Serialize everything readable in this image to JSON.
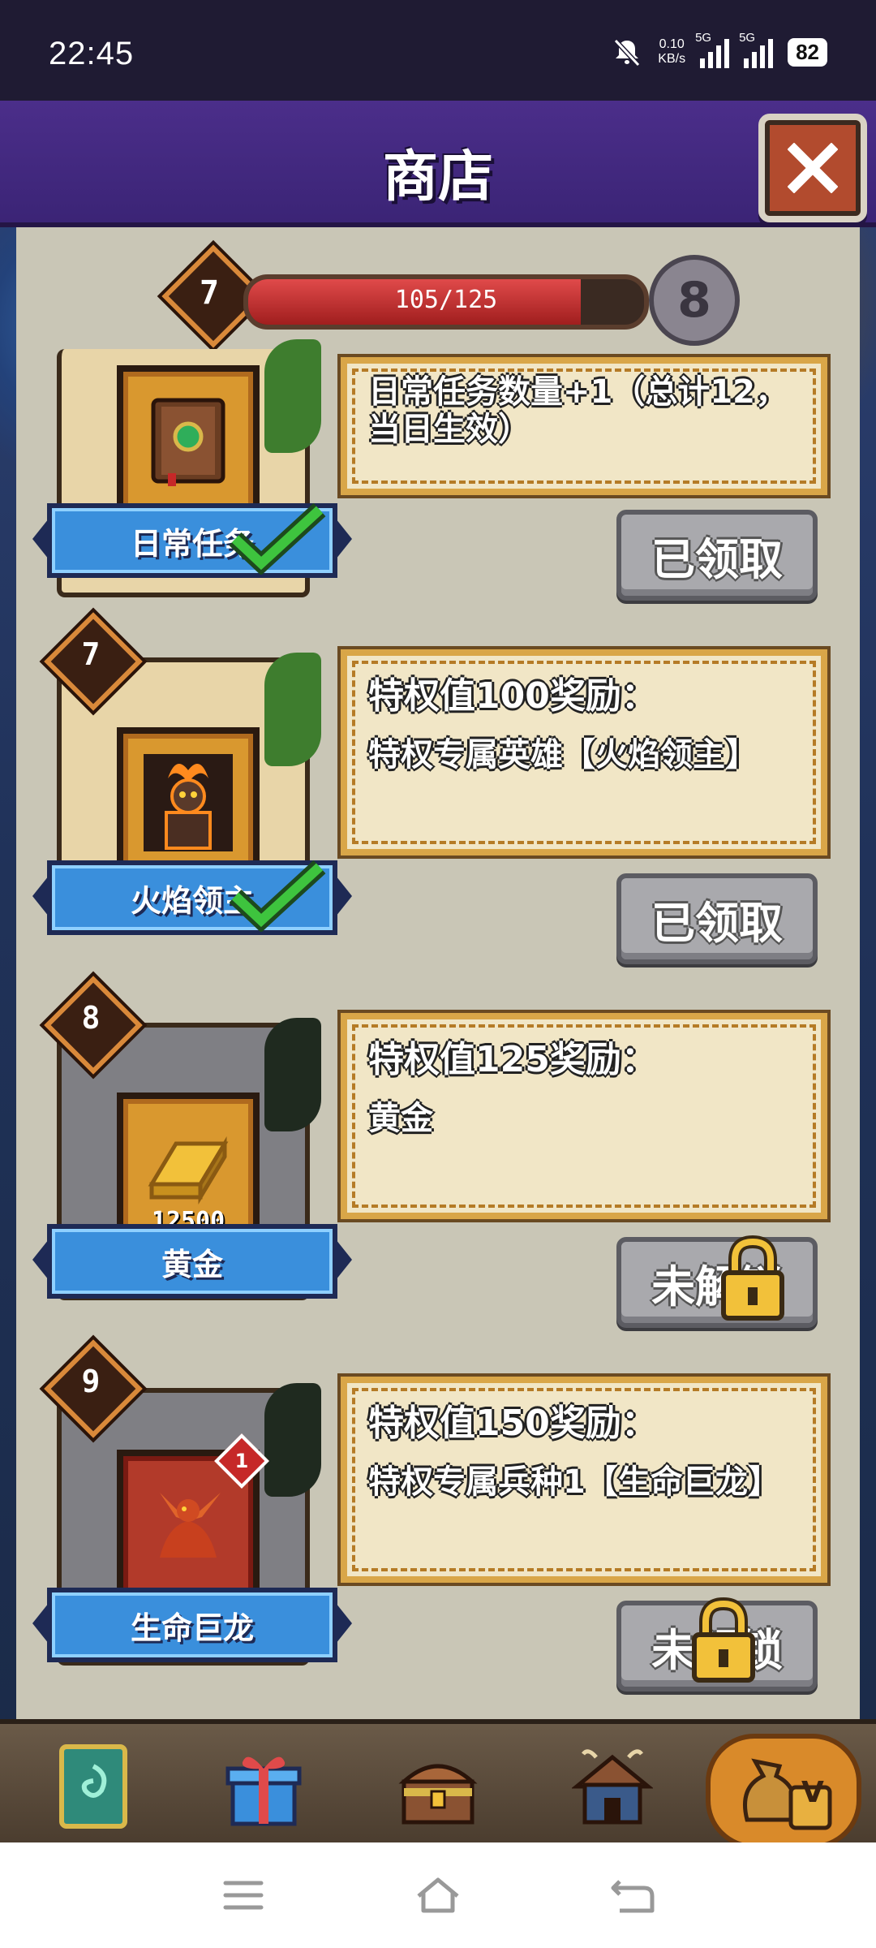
{
  "status_bar": {
    "time": "22:45",
    "net_speed_value": "0.10",
    "net_speed_unit": "KB/s",
    "signal1": "5G",
    "signal2": "5G",
    "battery": "82"
  },
  "header": {
    "title": "商店"
  },
  "level": {
    "current": "7",
    "progress_text": "105/125",
    "progress_fraction": 0.84,
    "next": "8"
  },
  "rewards": [
    {
      "card_label": "日常任务",
      "desc_title": "日常任务数量+1（总计12，当日生效）",
      "desc_sub": "",
      "button": "已领取",
      "state": "claimed"
    },
    {
      "rank": "7",
      "card_label": "火焰领主",
      "desc_title": "特权值100奖励：",
      "desc_sub": "特权专属英雄【火焰领主】",
      "button": "已领取",
      "state": "claimed"
    },
    {
      "rank": "8",
      "card_label": "黄金",
      "amount": "12500",
      "desc_title": "特权值125奖励：",
      "desc_sub": "黄金",
      "button": "未解锁",
      "state": "locked"
    },
    {
      "rank": "9",
      "card_label": "生命巨龙",
      "badge": "1",
      "desc_title": "特权值150奖励：",
      "desc_sub": "特权专属兵种1【生命巨龙】",
      "button": "未解锁",
      "state": "locked"
    }
  ],
  "tabs": [
    {
      "icon": "card-icon"
    },
    {
      "icon": "gift-icon"
    },
    {
      "icon": "treasure-chest-icon"
    },
    {
      "icon": "house-icon"
    },
    {
      "icon": "money-bag-vip-icon",
      "active": true,
      "label": "V"
    }
  ],
  "colors": {
    "header": "#4b2e8a",
    "ribbon": "#3a8fdc",
    "progress": "#c62828",
    "check": "#3ec43e"
  }
}
